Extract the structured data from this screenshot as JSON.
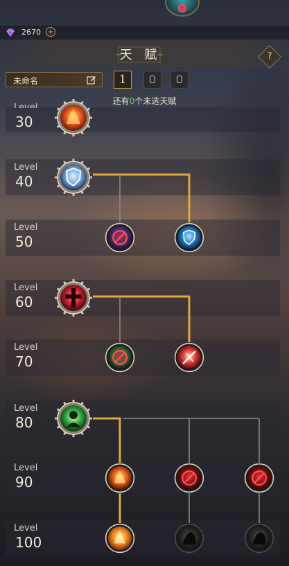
{
  "currency": {
    "value": "2670",
    "icon": "purple-gem-icon",
    "add_icon": "plus-icon"
  },
  "header": {
    "title": "天 赋"
  },
  "loadout": {
    "name": "未命名",
    "edit_icon": "pencil-icon",
    "active_slot": "1",
    "locked_slots": 2
  },
  "remaining": {
    "prefix": "还有",
    "count": "0",
    "suffix": "个未选天赋"
  },
  "colors": {
    "accent_gold": "#c99a52",
    "path_active": "#e0a93a",
    "path_inactive": "#8c8c8c",
    "remaining_count": "#4fdc6a"
  },
  "rows": [
    {
      "label": "Level",
      "level": "30"
    },
    {
      "label": "Level",
      "level": "40"
    },
    {
      "label": "Level",
      "level": "50"
    },
    {
      "label": "Level",
      "level": "60"
    },
    {
      "label": "Level",
      "level": "70"
    },
    {
      "label": "Level",
      "level": "80"
    },
    {
      "label": "Level",
      "level": "90"
    },
    {
      "label": "Level",
      "level": "100"
    }
  ],
  "talents": [
    {
      "row": 0,
      "icon": "fire-burst-icon",
      "state": "selected"
    },
    {
      "row": 1,
      "icon": "shield-sword-icon",
      "state": "selected"
    },
    {
      "row": 2,
      "icon": "blocked-ring-icon",
      "state": "disabled"
    },
    {
      "row": 2,
      "icon": "shield-heart-icon",
      "state": "selected"
    },
    {
      "row": 3,
      "icon": "red-cross-icon",
      "state": "selected"
    },
    {
      "row": 4,
      "icon": "blocked-poison-icon",
      "state": "disabled"
    },
    {
      "row": 4,
      "icon": "broken-sword-icon",
      "state": "selected"
    },
    {
      "row": 5,
      "icon": "green-warrior-icon",
      "state": "selected"
    },
    {
      "row": 6,
      "icon": "fire-phoenix-icon",
      "state": "selected"
    },
    {
      "row": 6,
      "icon": "blocked-red-icon",
      "state": "disabled"
    },
    {
      "row": 6,
      "icon": "blocked-red-icon",
      "state": "disabled"
    },
    {
      "row": 7,
      "icon": "flower-blast-icon",
      "state": "selected"
    },
    {
      "row": 7,
      "icon": "shadow-beast-icon",
      "state": "locked"
    },
    {
      "row": 7,
      "icon": "shadow-wolf-icon",
      "state": "locked"
    }
  ]
}
